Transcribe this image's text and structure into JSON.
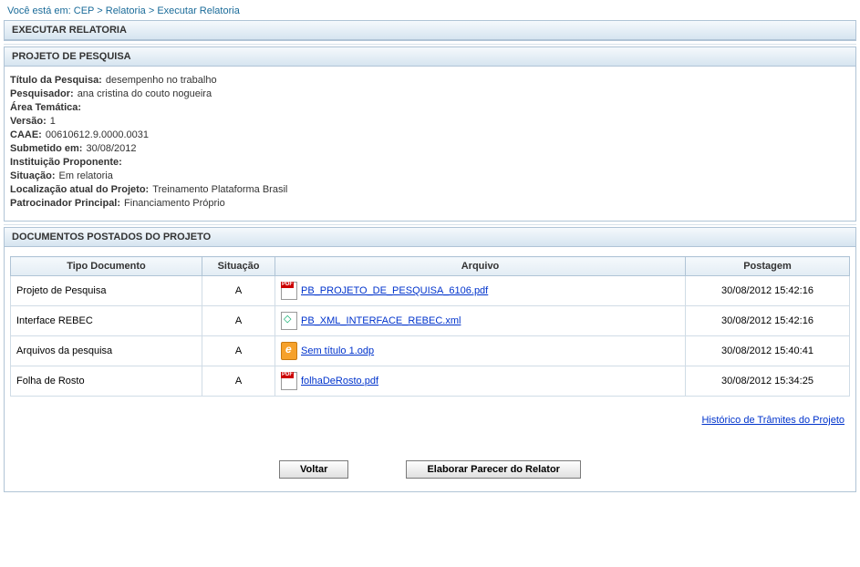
{
  "breadcrumb": {
    "prefix": "Você está em:",
    "parts": [
      "CEP",
      "Relatoria",
      "Executar Relatoria"
    ]
  },
  "section_exec": {
    "title": "EXECUTAR RELATORIA"
  },
  "section_project": {
    "title": "PROJETO DE PESQUISA",
    "fields": {
      "titulo_label": "Título da Pesquisa:",
      "titulo_value": "desempenho no trabalho",
      "pesq_label": "Pesquisador:",
      "pesq_value": "ana cristina do couto nogueira",
      "area_label": "Área Temática:",
      "area_value": "",
      "versao_label": "Versão:",
      "versao_value": "1",
      "caae_label": "CAAE:",
      "caae_value": "00610612.9.0000.0031",
      "submetido_label": "Submetido em:",
      "submetido_value": "30/08/2012",
      "inst_label": "Instituição Proponente:",
      "inst_value": "",
      "situacao_label": "Situação:",
      "situacao_value": "Em relatoria",
      "local_label": "Localização atual do Projeto:",
      "local_value": "Treinamento Plataforma Brasil",
      "patrocinador_label": "Patrocinador Principal:",
      "patrocinador_value": "Financiamento Próprio"
    }
  },
  "section_docs": {
    "title": "DOCUMENTOS POSTADOS DO PROJETO",
    "headers": {
      "tipo": "Tipo Documento",
      "situacao": "Situação",
      "arquivo": "Arquivo",
      "postagem": "Postagem"
    },
    "rows": [
      {
        "tipo": "Projeto de Pesquisa",
        "situacao": "A",
        "icon": "pdf",
        "arquivo": "PB_PROJETO_DE_PESQUISA_6106.pdf",
        "post": "30/08/2012 15:42:16"
      },
      {
        "tipo": "Interface REBEC",
        "situacao": "A",
        "icon": "xml",
        "arquivo": "PB_XML_INTERFACE_REBEC.xml",
        "post": "30/08/2012 15:42:16"
      },
      {
        "tipo": "Arquivos da pesquisa",
        "situacao": "A",
        "icon": "odp",
        "arquivo": "Sem título 1.odp",
        "post": "30/08/2012 15:40:41"
      },
      {
        "tipo": "Folha de Rosto",
        "situacao": "A",
        "icon": "pdf",
        "arquivo": "folhaDeRosto.pdf",
        "post": "30/08/2012 15:34:25"
      }
    ]
  },
  "history_link": "Histórico de Trâmites do Projeto",
  "buttons": {
    "voltar": "Voltar",
    "elaborar": "Elaborar Parecer do Relator"
  }
}
